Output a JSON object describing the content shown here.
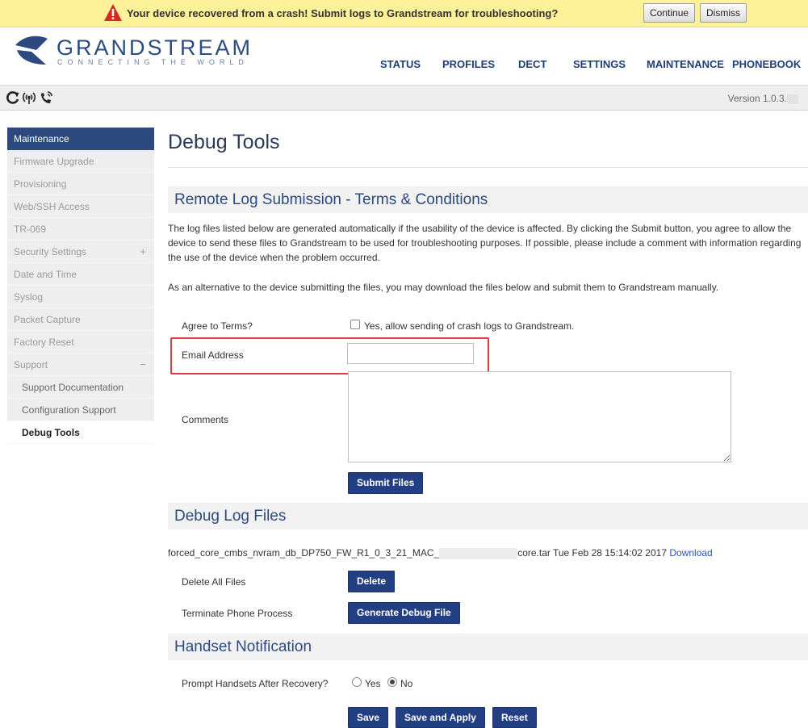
{
  "banner": {
    "message": "Your device recovered from a crash! Submit logs to Grandstream for troubleshooting?",
    "continue_label": "Continue",
    "dismiss_label": "Dismiss",
    "icon": "warning-triangle-icon"
  },
  "header": {
    "brand": "GRANDSTREAM",
    "tagline": "CONNECTING THE WORLD",
    "nav": [
      "STATUS",
      "PROFILES",
      "DECT",
      "SETTINGS",
      "MAINTENANCE",
      "PHONEBOOK"
    ]
  },
  "statusbar": {
    "icons": [
      "refresh-icon",
      "wireless-signal-icon",
      "phone-ringing-icon"
    ],
    "version": "Version 1.0.3."
  },
  "sidebar": {
    "heading": "Maintenance",
    "items": [
      {
        "label": "Firmware Upgrade"
      },
      {
        "label": "Provisioning"
      },
      {
        "label": "Web/SSH Access"
      },
      {
        "label": "TR-069"
      },
      {
        "label": "Security Settings",
        "expander": "+"
      },
      {
        "label": "Date and Time"
      },
      {
        "label": "Syslog"
      },
      {
        "label": "Packet Capture"
      },
      {
        "label": "Factory Reset"
      },
      {
        "label": "Support",
        "expander": "−"
      },
      {
        "label": "Support Documentation"
      },
      {
        "label": "Configuration Support"
      },
      {
        "label": "Debug Tools"
      }
    ]
  },
  "main": {
    "title": "Debug Tools",
    "remote_log": {
      "heading": "Remote Log Submission - Terms & Conditions",
      "para1": "The log files listed below are generated automatically if the usability of the device is affected. By clicking the Submit button, you agree to allow the device to send these files to Grandstream to be used for troubleshooting purposes. If possible, please include a comment with information regarding the use of the device when the problem occurred.",
      "para2": "As an alternative to the device submitting the files, you may download the files below and submit them to Grandstream manually.",
      "agree_label": "Agree to Terms?",
      "agree_checkbox_text": "Yes, allow sending of crash logs to Grandstream.",
      "email_label": "Email Address",
      "email_value": "",
      "comments_label": "Comments",
      "comments_value": "",
      "submit_label": "Submit Files"
    },
    "debug_files": {
      "heading": "Debug Log Files",
      "file_prefix": "forced_core_cmbs_nvram_db_DP750_FW_R1_0_3_21_MAC_",
      "file_suffix": "core.tar Tue Feb 28 15:14:02 2017",
      "download_label": "Download",
      "delete_all_label": "Delete All Files",
      "delete_button": "Delete",
      "terminate_label": "Terminate Phone Process",
      "generate_button": "Generate Debug File"
    },
    "handset": {
      "heading": "Handset Notification",
      "prompt_label": "Prompt Handsets After Recovery?",
      "yes_label": "Yes",
      "no_label": "No",
      "selected": "No"
    },
    "actions": {
      "save": "Save",
      "save_apply": "Save and Apply",
      "reset": "Reset"
    }
  }
}
